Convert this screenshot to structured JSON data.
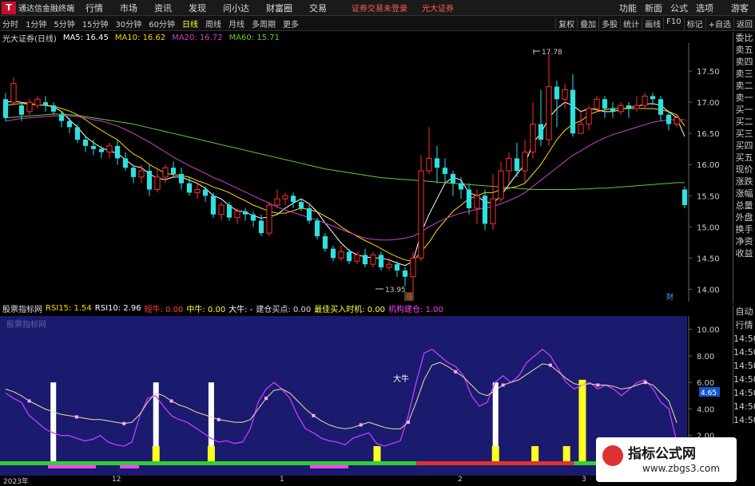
{
  "menubar": {
    "app_name": "通达信金融终端",
    "items": [
      "行情",
      "市场",
      "资讯",
      "发现",
      "问小达",
      "财富圈",
      "交易"
    ],
    "notice": "证券交易未登录",
    "broker": "光大证券",
    "right_items": [
      "功能",
      "新面",
      "公式",
      "选项"
    ],
    "guest": "游客"
  },
  "toolbar": {
    "periods": [
      "分时",
      "1分钟",
      "5分钟",
      "15分钟",
      "30分钟",
      "60分钟",
      "日线",
      "周线",
      "月线",
      "多周期",
      "更多"
    ],
    "active": "日线",
    "right_items": [
      "复权",
      "叠加",
      "多股",
      "统计",
      "画线",
      "F10",
      "标记",
      "+自选",
      "返回"
    ]
  },
  "main_legend": {
    "title": "光大证券(日线)",
    "ma5": "MA5: 16.45",
    "ma10": "MA10: 16.62",
    "ma20": "MA20: 16.72",
    "ma60": "MA60: 15.71"
  },
  "annotations": {
    "high": "17.78",
    "low": "13.95",
    "tag_zhang": "涨",
    "tag_cai": "财"
  },
  "price_axis": [
    "17.50",
    "17.00",
    "16.50",
    "16.00",
    "15.50",
    "15.00",
    "14.50",
    "14.00"
  ],
  "rsi_axis": [
    "10.00",
    "8.00",
    "6.00",
    "4.65",
    "4.00",
    "2.00"
  ],
  "rsi_legend": {
    "name": "股票指标网",
    "rsi15": "RSI15: 1.54",
    "rsi10": "RSI10: 2.96",
    "zhaoniu": "短牛: 0.00",
    "zhongniu": "中牛: 0.00",
    "daniu": "大牛: -",
    "jiancang": "建仓买点: 0.00",
    "zuijia": "最佳买入时机: 0.00",
    "jigou": "机构建仓: 1.00"
  },
  "rsi_panel": {
    "watermark": "股票指标网",
    "daniu_label": "大牛",
    "value_tag": "4.65"
  },
  "side_panel": [
    "委比",
    "卖五",
    "卖四",
    "卖三",
    "卖二",
    "卖一",
    "买一",
    "买二",
    "买三",
    "买四",
    "买五",
    "现价",
    "涨跌",
    "涨幅",
    "总量",
    "外盘",
    "换手",
    "净资",
    "收益"
  ],
  "side_panel2": [
    "自动",
    "行情",
    "14:50",
    "14:50",
    "14:50",
    "14:50",
    "14:50",
    "14:50",
    "14:50"
  ],
  "x_axis": [
    "2023年",
    "12",
    "1",
    "2",
    "3"
  ],
  "watermark_logo": {
    "title": "指标公式网",
    "url": "www.zbgs3.com"
  },
  "chart_data": {
    "type": "candlestick",
    "ylim": [
      13.8,
      17.95
    ],
    "candles": [
      [
        17.05,
        16.75,
        17.15,
        16.7
      ],
      [
        17.0,
        17.3,
        17.4,
        16.95
      ],
      [
        16.95,
        16.8,
        17.0,
        16.7
      ],
      [
        16.85,
        17.0,
        17.05,
        16.8
      ],
      [
        16.95,
        17.05,
        17.1,
        16.9
      ],
      [
        17.0,
        16.95,
        17.1,
        16.85
      ],
      [
        16.95,
        16.85,
        17.0,
        16.8
      ],
      [
        16.8,
        16.7,
        16.85,
        16.6
      ],
      [
        16.7,
        16.6,
        16.75,
        16.5
      ],
      [
        16.6,
        16.4,
        16.65,
        16.35
      ],
      [
        16.4,
        16.3,
        16.45,
        16.2
      ],
      [
        16.3,
        16.25,
        16.4,
        16.15
      ],
      [
        16.25,
        16.2,
        16.3,
        16.1
      ],
      [
        16.2,
        16.3,
        16.35,
        16.1
      ],
      [
        16.3,
        16.1,
        16.4,
        16.0
      ],
      [
        16.1,
        15.95,
        16.2,
        15.9
      ],
      [
        15.95,
        15.8,
        16.0,
        15.7
      ],
      [
        15.8,
        15.9,
        16.0,
        15.7
      ],
      [
        15.9,
        15.6,
        16.0,
        15.5
      ],
      [
        15.6,
        15.8,
        15.95,
        15.55
      ],
      [
        15.8,
        15.95,
        16.0,
        15.7
      ],
      [
        15.95,
        15.85,
        16.05,
        15.8
      ],
      [
        15.85,
        15.7,
        15.95,
        15.6
      ],
      [
        15.7,
        15.55,
        15.8,
        15.5
      ],
      [
        15.55,
        15.6,
        15.7,
        15.45
      ],
      [
        15.6,
        15.5,
        15.65,
        15.4
      ],
      [
        15.5,
        15.2,
        15.55,
        15.15
      ],
      [
        15.2,
        15.35,
        15.4,
        15.1
      ],
      [
        15.35,
        15.15,
        15.4,
        15.1
      ],
      [
        15.15,
        15.25,
        15.3,
        15.05
      ],
      [
        15.25,
        15.2,
        15.3,
        15.1
      ],
      [
        15.2,
        15.1,
        15.25,
        15.0
      ],
      [
        15.1,
        14.9,
        15.2,
        14.85
      ],
      [
        14.9,
        15.35,
        15.4,
        14.85
      ],
      [
        15.35,
        15.45,
        15.6,
        15.3
      ],
      [
        15.45,
        15.5,
        15.55,
        15.35
      ],
      [
        15.5,
        15.4,
        15.55,
        15.3
      ],
      [
        15.4,
        15.3,
        15.45,
        15.25
      ],
      [
        15.3,
        15.1,
        15.35,
        15.05
      ],
      [
        15.1,
        14.85,
        15.15,
        14.8
      ],
      [
        14.85,
        14.65,
        14.9,
        14.6
      ],
      [
        14.65,
        14.5,
        14.7,
        14.45
      ],
      [
        14.5,
        14.6,
        14.7,
        14.45
      ],
      [
        14.6,
        14.45,
        14.65,
        14.4
      ],
      [
        14.45,
        14.55,
        14.6,
        14.4
      ],
      [
        14.55,
        14.4,
        14.65,
        14.35
      ],
      [
        14.4,
        14.55,
        14.6,
        14.35
      ],
      [
        14.55,
        14.35,
        14.6,
        14.3
      ],
      [
        14.35,
        14.4,
        14.5,
        14.3
      ],
      [
        14.4,
        14.3,
        14.45,
        14.2
      ],
      [
        14.3,
        14.2,
        14.35,
        14.05
      ],
      [
        14.2,
        14.5,
        14.6,
        13.95
      ],
      [
        14.5,
        15.9,
        16.15,
        14.45
      ],
      [
        15.9,
        16.1,
        16.6,
        15.85
      ],
      [
        16.1,
        15.95,
        16.3,
        15.7
      ],
      [
        15.95,
        15.85,
        16.1,
        15.7
      ],
      [
        15.85,
        15.7,
        15.9,
        15.5
      ],
      [
        15.7,
        15.6,
        15.8,
        15.45
      ],
      [
        15.6,
        15.3,
        15.7,
        15.2
      ],
      [
        15.3,
        15.5,
        15.6,
        15.05
      ],
      [
        15.5,
        15.05,
        15.6,
        14.95
      ],
      [
        15.05,
        15.45,
        15.85,
        14.95
      ],
      [
        15.45,
        15.9,
        16.05,
        15.4
      ],
      [
        15.9,
        16.1,
        16.2,
        15.7
      ],
      [
        16.1,
        15.9,
        16.35,
        15.8
      ],
      [
        15.9,
        16.2,
        16.4,
        15.7
      ],
      [
        16.2,
        16.65,
        17.0,
        16.1
      ],
      [
        16.65,
        16.4,
        17.2,
        16.3
      ],
      [
        16.4,
        17.25,
        17.78,
        16.3
      ],
      [
        17.25,
        17.05,
        17.35,
        16.6
      ],
      [
        17.05,
        17.2,
        17.3,
        16.9
      ],
      [
        17.2,
        16.5,
        17.45,
        16.45
      ],
      [
        16.5,
        16.65,
        16.85,
        16.5
      ],
      [
        16.65,
        16.9,
        16.95,
        16.55
      ],
      [
        16.9,
        17.05,
        17.1,
        16.85
      ],
      [
        17.05,
        16.9,
        17.1,
        16.75
      ],
      [
        16.9,
        16.85,
        17.0,
        16.75
      ],
      [
        16.85,
        16.95,
        17.0,
        16.8
      ],
      [
        16.95,
        16.9,
        17.0,
        16.75
      ],
      [
        16.9,
        16.95,
        17.1,
        16.85
      ],
      [
        16.95,
        17.1,
        17.15,
        16.9
      ],
      [
        17.1,
        17.05,
        17.15,
        16.95
      ],
      [
        17.05,
        16.8,
        17.1,
        16.7
      ],
      [
        16.8,
        16.65,
        16.85,
        16.55
      ],
      [
        16.65,
        16.75,
        16.8,
        16.6
      ],
      [
        15.6,
        15.35,
        15.65,
        15.3
      ]
    ],
    "ma_series": [
      {
        "name": "MA5",
        "color": "#ffffff",
        "values": [
          17.0,
          17.02,
          17.0,
          16.98,
          16.96,
          16.95,
          16.93,
          16.85,
          16.72,
          16.6,
          16.45,
          16.35,
          16.27,
          16.22,
          16.18,
          16.08,
          15.98,
          15.95,
          15.85,
          15.78,
          15.76,
          15.8,
          15.8,
          15.75,
          15.7,
          15.62,
          15.5,
          15.45,
          15.34,
          15.26,
          15.24,
          15.18,
          15.14,
          15.16,
          15.2,
          15.3,
          15.38,
          15.45,
          15.37,
          15.24,
          15.06,
          14.9,
          14.74,
          14.62,
          14.55,
          14.52,
          14.5,
          14.5,
          14.47,
          14.42,
          14.38,
          14.45,
          14.9,
          15.2,
          15.45,
          15.7,
          15.8,
          15.75,
          15.55,
          15.5,
          15.4,
          15.38,
          15.5,
          15.68,
          15.85,
          16.0,
          16.35,
          16.5,
          16.75,
          16.9,
          17.0,
          16.95,
          16.85,
          16.9,
          16.88,
          16.85,
          16.85,
          16.88,
          16.92,
          16.93,
          16.97,
          16.98,
          16.95,
          16.85,
          16.75,
          16.45
        ]
      },
      {
        "name": "MA10",
        "color": "#ffd700",
        "values": [
          16.95,
          16.97,
          16.98,
          16.97,
          16.96,
          16.95,
          16.94,
          16.9,
          16.86,
          16.8,
          16.72,
          16.63,
          16.55,
          16.47,
          16.4,
          16.28,
          16.17,
          16.1,
          16.0,
          15.93,
          15.86,
          15.84,
          15.82,
          15.8,
          15.74,
          15.7,
          15.64,
          15.6,
          15.55,
          15.48,
          15.42,
          15.35,
          15.3,
          15.25,
          15.22,
          15.22,
          15.26,
          15.3,
          15.28,
          15.24,
          15.17,
          15.1,
          15.0,
          14.92,
          14.85,
          14.78,
          14.72,
          14.65,
          14.58,
          14.52,
          14.47,
          14.45,
          14.6,
          14.75,
          14.95,
          15.1,
          15.25,
          15.35,
          15.45,
          15.5,
          15.55,
          15.55,
          15.6,
          15.62,
          15.65,
          15.7,
          15.85,
          16.0,
          16.2,
          16.4,
          16.55,
          16.65,
          16.7,
          16.8,
          16.85,
          16.88,
          16.9,
          16.9,
          16.9,
          16.9,
          16.9,
          16.9,
          16.88,
          16.85,
          16.8,
          16.62
        ]
      },
      {
        "name": "MA20",
        "color": "#d040d0",
        "values": [
          16.7,
          16.72,
          16.74,
          16.75,
          16.76,
          16.77,
          16.78,
          16.78,
          16.78,
          16.77,
          16.75,
          16.72,
          16.7,
          16.66,
          16.62,
          16.56,
          16.5,
          16.43,
          16.36,
          16.28,
          16.2,
          16.12,
          16.05,
          15.98,
          15.92,
          15.86,
          15.79,
          15.74,
          15.68,
          15.62,
          15.56,
          15.5,
          15.44,
          15.38,
          15.32,
          15.27,
          15.23,
          15.19,
          15.15,
          15.11,
          15.06,
          15.01,
          14.96,
          14.91,
          14.86,
          14.82,
          14.8,
          14.79,
          14.79,
          14.8,
          14.82,
          14.85,
          14.92,
          15.0,
          15.07,
          15.13,
          15.18,
          15.22,
          15.25,
          15.28,
          15.3,
          15.33,
          15.37,
          15.42,
          15.48,
          15.55,
          15.65,
          15.75,
          15.85,
          15.95,
          16.05,
          16.15,
          16.22,
          16.3,
          16.37,
          16.43,
          16.48,
          16.52,
          16.56,
          16.6,
          16.64,
          16.68,
          16.7,
          16.72,
          16.72,
          16.72
        ]
      },
      {
        "name": "MA60",
        "color": "#66cc33",
        "values": [
          16.75,
          16.76,
          16.77,
          16.78,
          16.79,
          16.8,
          16.81,
          16.81,
          16.8,
          16.79,
          16.77,
          16.75,
          16.73,
          16.71,
          16.69,
          16.67,
          16.65,
          16.62,
          16.59,
          16.56,
          16.53,
          16.5,
          16.47,
          16.44,
          16.41,
          16.38,
          16.35,
          16.32,
          16.29,
          16.26,
          16.23,
          16.2,
          16.17,
          16.14,
          16.11,
          16.08,
          16.05,
          16.02,
          15.99,
          15.96,
          15.93,
          15.91,
          15.89,
          15.87,
          15.85,
          15.83,
          15.81,
          15.79,
          15.78,
          15.77,
          15.76,
          15.75,
          15.74,
          15.73,
          15.72,
          15.71,
          15.7,
          15.69,
          15.68,
          15.67,
          15.66,
          15.65,
          15.64,
          15.63,
          15.62,
          15.61,
          15.6,
          15.6,
          15.6,
          15.6,
          15.6,
          15.6,
          15.61,
          15.61,
          15.62,
          15.62,
          15.63,
          15.64,
          15.65,
          15.66,
          15.67,
          15.68,
          15.69,
          15.7,
          15.71,
          15.71
        ]
      }
    ],
    "rsi": {
      "ylim": [
        0,
        11
      ],
      "rsi15": [
        5.2,
        4.8,
        4.5,
        3.5,
        3.0,
        2.5,
        2.2,
        2.0,
        2.0,
        1.8,
        1.6,
        1.7,
        2.0,
        1.5,
        1.3,
        1.2,
        1.5,
        3.5,
        4.8,
        5.0,
        4.2,
        3.5,
        3.2,
        3.0,
        2.6,
        2.2,
        1.8,
        1.5,
        1.6,
        1.4,
        1.5,
        2.5,
        4.5,
        5.5,
        6.0,
        5.5,
        4.8,
        3.5,
        2.5,
        2.2,
        1.8,
        1.6,
        1.5,
        1.3,
        1.8,
        2.0,
        2.2,
        1.4,
        1.2,
        1.4,
        1.6,
        3.5,
        6.0,
        8.2,
        8.5,
        8.0,
        7.5,
        7.2,
        6.5,
        5.0,
        4.2,
        4.5,
        6.0,
        6.5,
        6.0,
        6.5,
        7.5,
        8.0,
        8.5,
        8.0,
        7.0,
        6.0,
        5.5,
        5.8,
        6.0,
        5.5,
        5.8,
        5.5,
        5.0,
        5.5,
        6.0,
        6.2,
        5.5,
        4.5,
        4.0,
        1.5
      ],
      "rsi10": [
        5.5,
        5.3,
        5.0,
        4.6,
        4.3,
        4.0,
        3.8,
        3.6,
        3.5,
        3.4,
        3.3,
        3.2,
        3.2,
        3.1,
        3.0,
        2.9,
        3.0,
        3.6,
        4.5,
        5.2,
        5.0,
        4.6,
        4.3,
        4.1,
        3.8,
        3.6,
        3.4,
        3.2,
        3.1,
        3.0,
        3.0,
        3.2,
        4.0,
        4.8,
        5.4,
        5.5,
        5.2,
        4.6,
        4.0,
        3.5,
        3.1,
        2.8,
        2.6,
        2.5,
        2.6,
        2.8,
        3.0,
        2.8,
        2.6,
        2.5,
        2.5,
        3.0,
        4.5,
        6.2,
        7.3,
        7.5,
        7.2,
        6.8,
        6.4,
        5.8,
        5.2,
        5.0,
        5.4,
        5.8,
        6.0,
        6.2,
        6.6,
        7.0,
        7.4,
        7.3,
        6.8,
        6.3,
        5.9,
        5.8,
        5.9,
        5.8,
        5.8,
        5.7,
        5.5,
        5.6,
        5.8,
        6.0,
        5.8,
        5.2,
        4.6,
        2.96
      ],
      "white_bars": [
        3,
        9,
        12,
        29
      ],
      "yellow_bars": [
        [
          9,
          1.2
        ],
        [
          12,
          1.2
        ],
        [
          22,
          1.2
        ],
        [
          29,
          1.2
        ],
        [
          31,
          1.2
        ],
        [
          33,
          1.2
        ],
        [
          34,
          6.2
        ]
      ]
    }
  }
}
